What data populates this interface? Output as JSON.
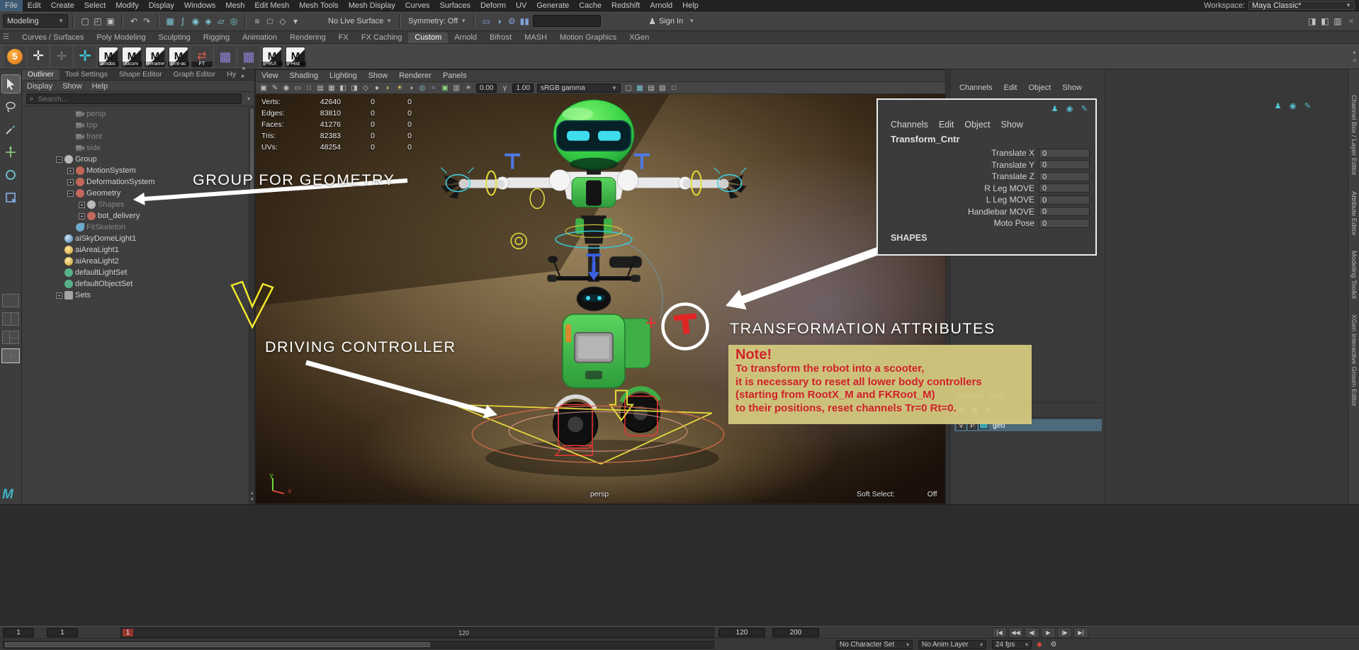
{
  "menubar": {
    "items": [
      "File",
      "Edit",
      "Create",
      "Select",
      "Modify",
      "Display",
      "Windows",
      "Mesh",
      "Edit Mesh",
      "Mesh Tools",
      "Mesh Display",
      "Curves",
      "Surfaces",
      "Deform",
      "UV",
      "Generate",
      "Cache",
      "Redshift",
      "Arnold",
      "Help"
    ],
    "workspace_label": "Workspace:",
    "workspace_value": "Maya Classic*"
  },
  "statusline": {
    "mode": "Modeling",
    "no_live_surface": "No Live Surface",
    "symmetry": "Symmetry: Off",
    "sign_in": "Sign In",
    "field_value": "",
    "file_icons": [
      {
        "name": "file-new-icon",
        "glyph": "▢"
      },
      {
        "name": "file-open-icon",
        "glyph": "◰"
      },
      {
        "name": "file-save-icon",
        "glyph": "▣"
      }
    ],
    "undo_icons": [
      {
        "name": "undo-icon",
        "glyph": "↶"
      },
      {
        "name": "redo-icon",
        "glyph": "↷"
      }
    ],
    "snap_icons": [
      {
        "name": "snap-to-grid-icon",
        "glyph": "▦"
      },
      {
        "name": "snap-to-curve-icon",
        "glyph": "∫"
      },
      {
        "name": "snap-to-point-icon",
        "glyph": "◉"
      },
      {
        "name": "snap-to-projected-center-icon",
        "glyph": "◈"
      },
      {
        "name": "snap-to-view-plane-icon",
        "glyph": "▱"
      },
      {
        "name": "make-live-icon",
        "glyph": "◎"
      }
    ],
    "selection_icons": [
      {
        "name": "select-hierarchy-icon",
        "glyph": "≡"
      },
      {
        "name": "select-object-icon",
        "glyph": "□"
      },
      {
        "name": "select-component-icon",
        "glyph": "◇"
      },
      {
        "name": "select-mask-icon",
        "glyph": "▾"
      }
    ],
    "render_icons": [
      {
        "name": "render-view-icon",
        "glyph": "▭"
      },
      {
        "name": "ipr-render-icon",
        "glyph": "◑"
      },
      {
        "name": "render-settings-icon",
        "glyph": "⚙"
      },
      {
        "name": "pause-viewport-icon",
        "glyph": "▮▮"
      }
    ],
    "sidebar_icons": [
      {
        "name": "attribute-editor-toggle-icon",
        "glyph": "◨"
      },
      {
        "name": "tool-settings-toggle-icon",
        "glyph": "◧"
      },
      {
        "name": "channel-box-toggle-icon",
        "glyph": "▥"
      }
    ]
  },
  "shelf": {
    "tabs": [
      {
        "label": "Curves / Surfaces"
      },
      {
        "label": "Poly Modeling"
      },
      {
        "label": "Sculpting"
      },
      {
        "label": "Rigging"
      },
      {
        "label": "Animation"
      },
      {
        "label": "Rendering"
      },
      {
        "label": "FX"
      },
      {
        "label": "FX Caching"
      },
      {
        "label": "Custom",
        "active": true
      },
      {
        "label": "Arnold"
      },
      {
        "label": "Bifrost"
      },
      {
        "label": "MASH"
      },
      {
        "label": "Motion Graphics"
      },
      {
        "label": "XGen"
      }
    ],
    "items": [
      {
        "name": "shelf-item-five",
        "kind": "ball",
        "glyph": "5",
        "label": ""
      },
      {
        "name": "shelf-item-skeleton-white",
        "kind": "skel-white",
        "glyph": "✛",
        "label": ""
      },
      {
        "name": "shelf-item-skeleton-dark",
        "kind": "skel-dark",
        "glyph": "✛",
        "label": ""
      },
      {
        "name": "shelf-item-skeleton-teal",
        "kind": "skel-teal",
        "glyph": "✛",
        "label": ""
      },
      {
        "name": "shelf-item-amdoc",
        "kind": "mel",
        "glyph": "M",
        "label": "amdoc"
      },
      {
        "name": "shelf-item-locurv",
        "kind": "mel",
        "glyph": "M",
        "label": "locurv"
      },
      {
        "name": "shelf-item-rename",
        "kind": "mel",
        "glyph": "M",
        "label": "Rename"
      },
      {
        "name": "shelf-item-prnt-ac",
        "kind": "mel",
        "glyph": "M",
        "label": "prnt-ac"
      },
      {
        "name": "shelf-item-ft",
        "kind": "arrows",
        "glyph": "⇄",
        "label": "FT"
      },
      {
        "name": "shelf-item-grid-a",
        "kind": "grid",
        "glyph": "▦",
        "label": ""
      },
      {
        "name": "shelf-item-grid-b",
        "kind": "grid",
        "glyph": "▦",
        "label": ""
      },
      {
        "name": "shelf-item-rui",
        "kind": "mel",
        "glyph": "M",
        "label": "RUI"
      },
      {
        "name": "shelf-item-hist",
        "kind": "mel",
        "glyph": "M",
        "label": "Hist"
      }
    ]
  },
  "outliner": {
    "tabs": [
      {
        "label": "Outliner",
        "active": true
      },
      {
        "label": "Tool Settings"
      },
      {
        "label": "Shape Editor"
      },
      {
        "label": "Graph Editor"
      },
      {
        "label": "Hy"
      }
    ],
    "menus": [
      "Display",
      "Show",
      "Help"
    ],
    "search_placeholder": "Search...",
    "tree": [
      {
        "label": "persp",
        "depth": 1,
        "icon": "camera",
        "expand": "none",
        "muted": true
      },
      {
        "label": "top",
        "depth": 1,
        "icon": "camera",
        "expand": "none",
        "muted": true
      },
      {
        "label": "front",
        "depth": 1,
        "icon": "camera",
        "expand": "none",
        "muted": true
      },
      {
        "label": "side",
        "depth": 1,
        "icon": "camera",
        "expand": "none",
        "muted": true
      },
      {
        "label": "Group",
        "depth": 0,
        "icon": "transform",
        "expand": "minus"
      },
      {
        "label": "MotionSystem",
        "depth": 1,
        "icon": "transform-red",
        "expand": "plus"
      },
      {
        "label": "DeformationSystem",
        "depth": 1,
        "icon": "transform-red",
        "expand": "plus"
      },
      {
        "label": "Geometry",
        "depth": 1,
        "icon": "transform-red",
        "expand": "minus"
      },
      {
        "label": "Shapes",
        "depth": 2,
        "icon": "transform",
        "expand": "plus",
        "muted": true
      },
      {
        "label": "bot_delivery",
        "depth": 2,
        "icon": "transform-red",
        "expand": "plus"
      },
      {
        "label": "FitSkeleton",
        "depth": 1,
        "icon": "curve",
        "expand": "none",
        "muted": true
      },
      {
        "label": "aiSkyDomeLight1",
        "depth": 0,
        "icon": "skydome",
        "expand": "none"
      },
      {
        "label": "aiAreaLight1",
        "depth": 0,
        "icon": "light",
        "expand": "none"
      },
      {
        "label": "aiAreaLight2",
        "depth": 0,
        "icon": "light",
        "expand": "none"
      },
      {
        "label": "defaultLightSet",
        "depth": 0,
        "icon": "set",
        "expand": "none"
      },
      {
        "label": "defaultObjectSet",
        "depth": 0,
        "icon": "set",
        "expand": "none"
      },
      {
        "label": "Sets",
        "depth": 0,
        "icon": "sets",
        "expand": "plus"
      }
    ]
  },
  "viewport": {
    "menus": [
      "View",
      "Shading",
      "Lighting",
      "Show",
      "Renderer",
      "Panels"
    ],
    "icons_a": [
      {
        "name": "select-camera-icon",
        "glyph": "▣"
      },
      {
        "name": "grease-pencil-icon",
        "glyph": "✎"
      },
      {
        "name": "camera-lock-icon",
        "glyph": "◉"
      },
      {
        "name": "film-gate-icon",
        "glyph": "▭"
      },
      {
        "name": "resolution-gate-icon",
        "glyph": "□"
      },
      {
        "name": "gate-mask-icon",
        "glyph": "▤"
      },
      {
        "name": "field-chart-icon",
        "glyph": "▦"
      },
      {
        "name": "safe-action-icon",
        "glyph": "◧"
      },
      {
        "name": "safe-title-icon",
        "glyph": "◨"
      },
      {
        "name": "wireframe-icon",
        "glyph": "◇"
      },
      {
        "name": "shaded-icon",
        "glyph": "●"
      },
      {
        "name": "textured-icon",
        "glyph": "◐",
        "color": "#d8b46a"
      },
      {
        "name": "use-all-lights-icon",
        "glyph": "☀",
        "color": "#e4cf6d"
      },
      {
        "name": "shadows-icon",
        "glyph": "◑"
      },
      {
        "name": "screen-space-ao-icon",
        "glyph": "◎",
        "color": "#7fc9d8"
      },
      {
        "name": "motion-blur-icon",
        "glyph": "≈",
        "color": "#7fa3d8"
      },
      {
        "name": "multisample-icon",
        "glyph": "▣",
        "color": "#8fd87f"
      },
      {
        "name": "xray-icon",
        "glyph": "▥"
      }
    ],
    "icons_b": [
      {
        "name": "isolate-select-icon",
        "glyph": "▢"
      },
      {
        "name": "grid-toggle-icon",
        "glyph": "▦",
        "color": "#7fc9d8"
      },
      {
        "name": "hud-toggle-icon",
        "glyph": "▤"
      },
      {
        "name": "background-gradient-icon",
        "glyph": "▨"
      },
      {
        "name": "outline-icon",
        "glyph": "□"
      }
    ],
    "exposure_value": "0.00",
    "gamma_value": "1.00",
    "colorspace": "sRGB gamma",
    "stats": [
      {
        "label": "Verts:",
        "v": "42640",
        "a": "0",
        "b": "0"
      },
      {
        "label": "Edges:",
        "v": "83810",
        "a": "0",
        "b": "0"
      },
      {
        "label": "Faces:",
        "v": "41276",
        "a": "0",
        "b": "0"
      },
      {
        "label": "Tris:",
        "v": "82383",
        "a": "0",
        "b": "0"
      },
      {
        "label": "UVs:",
        "v": "48254",
        "a": "0",
        "b": "0"
      }
    ],
    "camera_label": "persp",
    "soft_select": {
      "label": "Soft Select:",
      "value": "Off"
    },
    "axis": {
      "x": "x",
      "y": "y"
    }
  },
  "channel_box_overlay": {
    "menus": [
      "Channels",
      "Edit",
      "Object",
      "Show"
    ],
    "icons": [
      {
        "name": "channel-pin-icon",
        "glyph": "♟"
      },
      {
        "name": "channel-manip-icon",
        "glyph": "◉"
      },
      {
        "name": "channel-edit-icon",
        "glyph": "✎"
      }
    ],
    "node_name": "Transform_Cntr",
    "attributes": [
      {
        "label": "Translate X",
        "value": "0"
      },
      {
        "label": "Translate Y",
        "value": "0"
      },
      {
        "label": "Translate Z",
        "value": "0"
      },
      {
        "label": "R Leg MOVE",
        "value": "0"
      },
      {
        "label": "L Leg MOVE",
        "value": "0"
      },
      {
        "label": "Handlebar MOVE",
        "value": "0"
      },
      {
        "label": "Moto Pose",
        "value": "0"
      }
    ],
    "shapes_label": "SHAPES"
  },
  "dock": {
    "menus": [
      "Channels",
      "Edit",
      "Object",
      "Show"
    ],
    "icons": [
      {
        "name": "dock-pin-icon",
        "glyph": "♟"
      },
      {
        "name": "dock-manip-icon",
        "glyph": "◉"
      },
      {
        "name": "dock-edit-icon",
        "glyph": "✎"
      }
    ],
    "layer_menus": [
      "Options",
      "Help"
    ],
    "layer_icons": [
      {
        "name": "layer-visible-icon",
        "glyph": "◉"
      },
      {
        "name": "layer-playback-icon",
        "glyph": "▣"
      },
      {
        "name": "layer-new-icon",
        "glyph": "✚"
      }
    ],
    "layer": {
      "v": "V",
      "p": "P",
      "name": "geo"
    },
    "side_tabs": [
      "Channel Box / Layer Editor",
      "Attribute Editor",
      "Modeling Toolkit",
      "XGen Interactive Groom Editor"
    ]
  },
  "annotations": {
    "group_for_geometry": "GROUP FOR GEOMETRY",
    "driving_controller": "DRIVING CONTROLLER",
    "transformation_attributes": "TRANSFORMATION ATTRIBUTES",
    "note_title": "Note!",
    "note_lines": [
      "To transform the robot into a scooter,",
      "it is necessary to reset all lower body controllers",
      "(starting from RootX_M and FKRoot_M)",
      "to their positions, reset channels Tr=0 Rt=0."
    ]
  },
  "timeline": {
    "playback_start": "1",
    "current_time": "1",
    "slider_start_label": "1",
    "slider_end_label": "120",
    "playback_end": "120",
    "animation_end": "200",
    "transport": [
      {
        "name": "go-to-start-button",
        "glyph": "|◀"
      },
      {
        "name": "step-back-key-button",
        "glyph": "◀◀"
      },
      {
        "name": "step-back-frame-button",
        "glyph": "◀|"
      },
      {
        "name": "play-button",
        "glyph": "▶"
      },
      {
        "name": "step-forward-frame-button",
        "glyph": "|▶"
      },
      {
        "name": "go-to-end-button",
        "glyph": "▶|"
      }
    ],
    "character_set": "No Character Set",
    "anim_layer": "No Anim Layer",
    "fps": "24 fps",
    "anim_icons": [
      {
        "name": "auto-key-icon",
        "glyph": "◆",
        "color": "#cf4a3a"
      },
      {
        "name": "animation-preferences-icon",
        "glyph": "⚙"
      }
    ]
  }
}
